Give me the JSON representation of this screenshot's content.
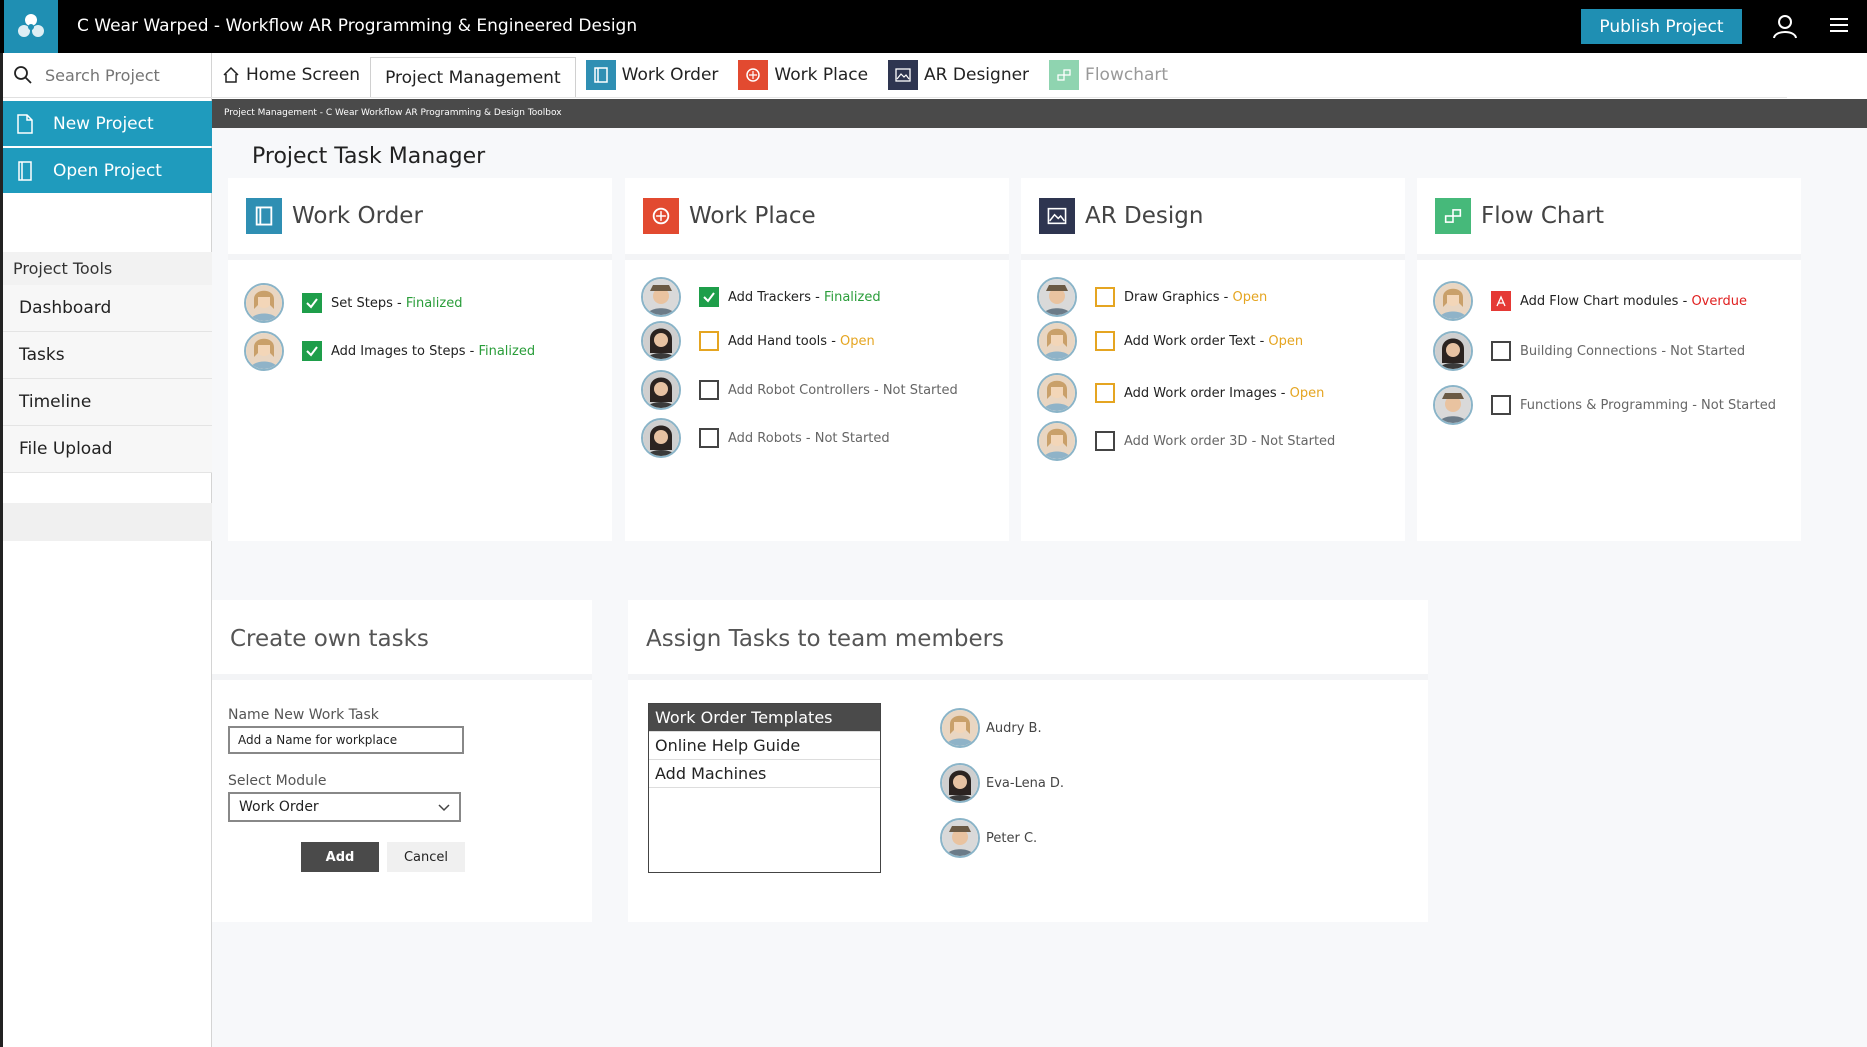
{
  "app": {
    "title": "C Wear Warped - Workflow AR Programming & Engineered Design",
    "publish_label": "Publish Project"
  },
  "sidebar": {
    "search_placeholder": "Search Project",
    "new_project": "New Project",
    "open_project": "Open Project",
    "tools_header": "Project Tools",
    "tools": [
      "Dashboard",
      "Tasks",
      "Timeline",
      "File Upload"
    ]
  },
  "tabs": [
    {
      "label": "Home Screen",
      "icon": "home-icon"
    },
    {
      "label": "Project Management",
      "icon": ""
    },
    {
      "label": "Work Order",
      "icon": "work-order-icon"
    },
    {
      "label": "Work Place",
      "icon": "work-place-icon"
    },
    {
      "label": "AR Designer",
      "icon": "ar-designer-icon"
    },
    {
      "label": "Flowchart",
      "icon": "flowchart-icon"
    }
  ],
  "breadcrumb": "Project Management - C Wear Workflow AR Programming & Design Toolbox",
  "main": {
    "page_title": "Project Task Manager",
    "cards": [
      {
        "title": "Work Order",
        "color": "#2f8fb3",
        "tasks": [
          {
            "name": "Set Steps",
            "sep": " - ",
            "status": "Finalized",
            "state": "done"
          },
          {
            "name": "Add Images to Steps",
            "sep": " - ",
            "status": "Finalized",
            "state": "done"
          }
        ]
      },
      {
        "title": "Work Place",
        "color": "#e24a30",
        "tasks": [
          {
            "name": "Add Trackers",
            "sep": " - ",
            "status": "Finalized",
            "state": "done"
          },
          {
            "name": "Add Hand tools",
            "sep": " - ",
            "status": "Open",
            "state": "open"
          },
          {
            "name": "Add Robot Controllers - Not Started",
            "sep": "",
            "status": "",
            "state": "empty"
          },
          {
            "name": "Add Robots - Not Started",
            "sep": "",
            "status": "",
            "state": "empty"
          }
        ]
      },
      {
        "title": "AR Design",
        "color": "#2e3550",
        "tasks": [
          {
            "name": "Draw Graphics",
            "sep": " - ",
            "status": "Open",
            "state": "open"
          },
          {
            "name": "Add Work order Text",
            "sep": " - ",
            "status": "Open",
            "state": "open"
          },
          {
            "name": "Add Work order Images",
            "sep": " - ",
            "status": "Open",
            "state": "open"
          },
          {
            "name": "Add Work order 3D - Not Started",
            "sep": "",
            "status": "",
            "state": "empty"
          }
        ]
      },
      {
        "title": "Flow Chart",
        "color": "#46b97a",
        "tasks": [
          {
            "name": "Add Flow Chart modules",
            "sep": " - ",
            "status": "Overdue",
            "state": "overdue"
          },
          {
            "name": "Building Connections - Not Started",
            "sep": "",
            "status": "",
            "state": "empty"
          },
          {
            "name": "Functions & Programming - Not Started",
            "sep": "",
            "status": "",
            "state": "empty"
          }
        ]
      }
    ],
    "create": {
      "title": "Create own tasks",
      "name_label": "Name New Work Task",
      "name_value": "Add a Name for workplace",
      "module_label": "Select Module",
      "module_value": "Work Order",
      "add_label": "Add",
      "cancel_label": "Cancel"
    },
    "assign": {
      "title": "Assign Tasks to team members",
      "templates": [
        "Work Order Templates",
        "Online Help Guide",
        "Add Machines"
      ],
      "members": [
        "Audry B.",
        "Eva-Lena D.",
        "Peter C."
      ]
    }
  }
}
